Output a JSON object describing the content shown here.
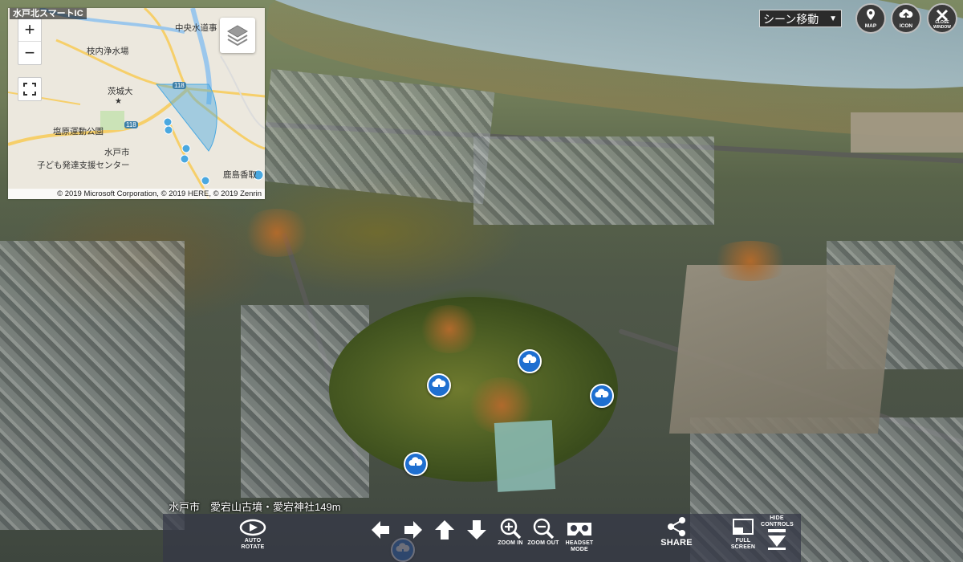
{
  "map": {
    "title": "水戸北スマートIC",
    "labels": {
      "chuo": "中央水道事",
      "edauchi": "枝内浄水場",
      "ibadai": "茨城大",
      "shiohara": "塩原運動公園",
      "mitoshi": "水戸市",
      "kodomo": "子ども発達支援センター",
      "kashima": "鹿島香取",
      "route118a": "118",
      "route118b": "118"
    },
    "zoom_in": "+",
    "zoom_out": "−",
    "copyright": "© 2019 Microsoft Corporation, © 2019 HERE, © 2019 Zenrin"
  },
  "top": {
    "scene_select": "シーン移動",
    "map_button": "MAP",
    "icon_button": "ICON",
    "close_button": "CLOSE WINDOW"
  },
  "caption": "水戸市　愛宕山古墳・愛宕神社149m",
  "controls": {
    "autorotate": "AUTO ROTATE",
    "zoom_in": "ZOOM IN",
    "zoom_out": "ZOOM OUT",
    "headset": "HEADSET MODE",
    "share": "SHARE",
    "fullscreen": "FULL SCREEN",
    "hide_controls": "HIDE CONTROLS"
  },
  "colors": {
    "hotspot": "#1e6fd0",
    "control_bar": "#343846",
    "map_route": "#7fb8e6",
    "map_coverage": "#4aa8e0"
  },
  "icons": [
    "cloud-download-icon",
    "layers-icon",
    "fullscreen-icon",
    "map-icon",
    "icon-toggle-icon",
    "close-icon",
    "autorotate-icon",
    "arrow-left-icon",
    "arrow-right-icon",
    "arrow-up-icon",
    "arrow-down-icon",
    "zoom-in-icon",
    "zoom-out-icon",
    "headset-icon",
    "share-icon",
    "fullscreen-icon",
    "hide-controls-icon"
  ]
}
